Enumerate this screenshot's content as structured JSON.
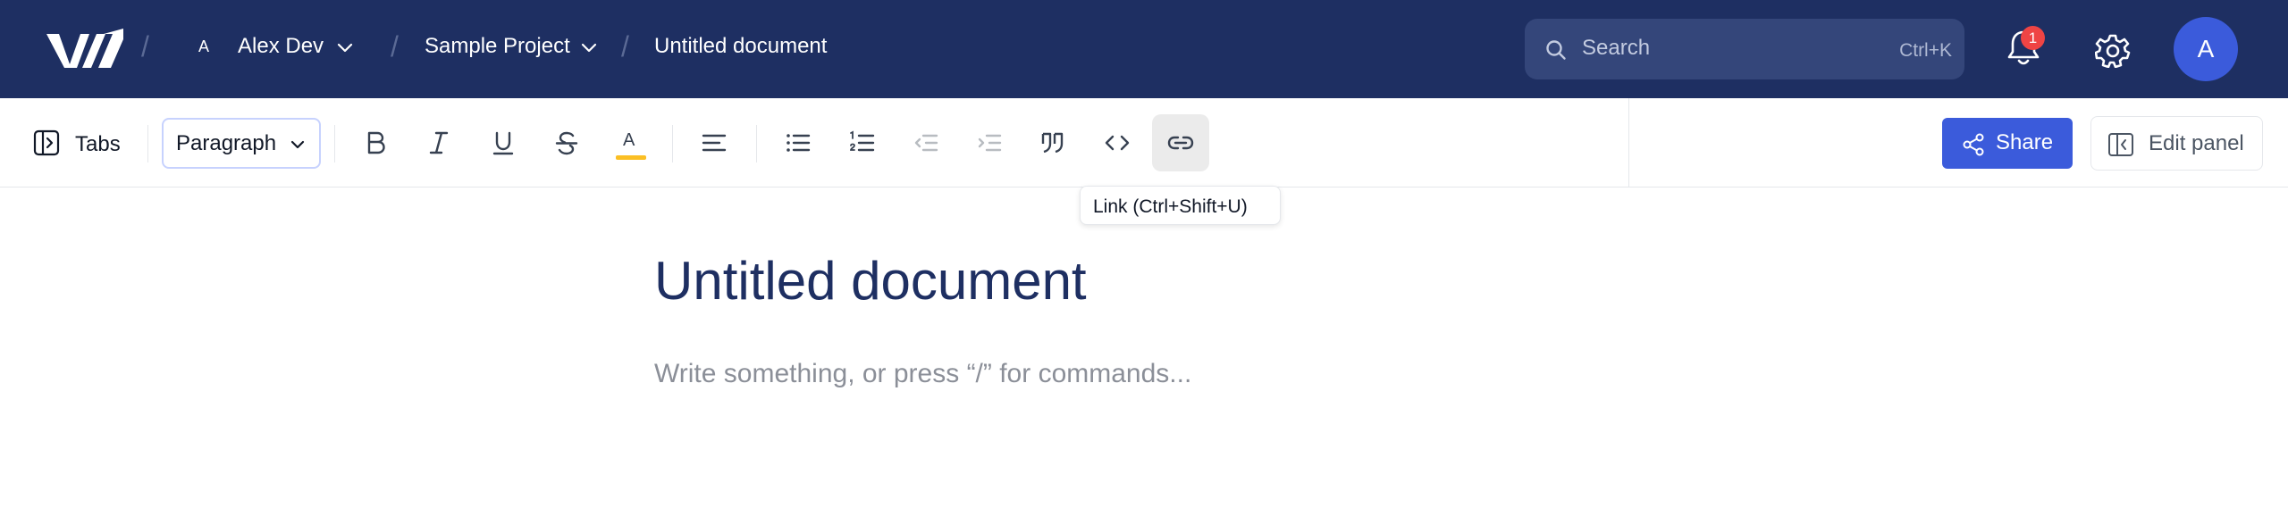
{
  "topbar": {
    "workspace_initial": "A",
    "workspace_name": "Alex Dev",
    "separator": "/",
    "project_name": "Sample Project",
    "document_name": "Untitled document",
    "search": {
      "placeholder": "Search",
      "shortcut": "Ctrl+K"
    },
    "notifications_count": "1",
    "user_initial": "A",
    "icons": [
      "logo-icon",
      "chevron-down-icon",
      "search-icon",
      "bell-icon",
      "gear-icon"
    ],
    "colors": {
      "background": "#1e2f62",
      "badge": "#ef4444",
      "avatar": "#3b5bdb"
    }
  },
  "toolbar": {
    "tabs_label": "Tabs",
    "block_type": "Paragraph",
    "tools": [
      "bold",
      "italic",
      "underline",
      "strikethrough",
      "highlight",
      "align",
      "bullet-list",
      "numbered-list",
      "outdent",
      "indent",
      "blockquote",
      "code",
      "link"
    ],
    "highlight_glyph": "A",
    "share_label": "Share",
    "edit_panel_label": "Edit panel",
    "colors": {
      "accent": "#3b5bdb",
      "highlight": "#fbbf24"
    }
  },
  "tooltip": {
    "text": "Link (Ctrl+Shift+U)"
  },
  "document": {
    "title": "Untitled document",
    "placeholder": "Write something, or press “/” for commands..."
  }
}
